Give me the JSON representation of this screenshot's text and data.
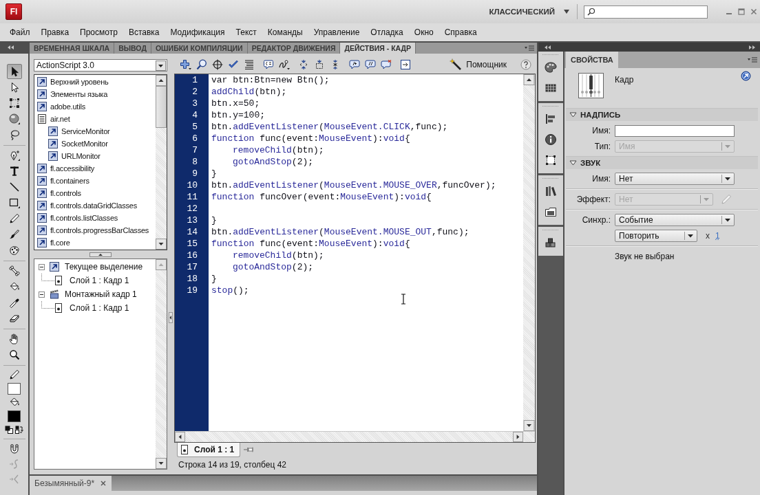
{
  "app": {
    "logo": "Fl",
    "workspace": "КЛАССИЧЕСКИЙ"
  },
  "menu": [
    "Файл",
    "Правка",
    "Просмотр",
    "Вставка",
    "Модификация",
    "Текст",
    "Команды",
    "Управление",
    "Отладка",
    "Окно",
    "Справка"
  ],
  "panel_tabs": [
    {
      "label": "ВРЕМЕННАЯ ШКАЛА",
      "selected": false
    },
    {
      "label": "ВЫВОД",
      "selected": false
    },
    {
      "label": "ОШИБКИ КОМПИЛЯЦИИ",
      "selected": false
    },
    {
      "label": "РЕДАКТОР ДВИЖЕНИЯ",
      "selected": false
    },
    {
      "label": "ДЕЙСТВИЯ - КАДР",
      "selected": true
    }
  ],
  "tool_groups": [
    {
      "tools": [
        {
          "kind": "selection",
          "selected": true
        },
        {
          "kind": "subselection",
          "selected": false
        },
        {
          "kind": "transform",
          "selected": false
        },
        {
          "kind": "rotate3d",
          "selected": false
        },
        {
          "kind": "lasso",
          "selected": false
        }
      ]
    },
    {
      "tools": [
        {
          "kind": "pen",
          "selected": false
        },
        {
          "kind": "text",
          "selected": false
        },
        {
          "kind": "line",
          "selected": false
        },
        {
          "kind": "rectangle",
          "selected": false
        },
        {
          "kind": "pencil",
          "selected": false
        },
        {
          "kind": "brush",
          "selected": false
        },
        {
          "kind": "deco",
          "selected": false
        }
      ]
    },
    {
      "tools": [
        {
          "kind": "bone",
          "selected": false
        },
        {
          "kind": "bucket",
          "selected": false
        },
        {
          "kind": "eyedropper",
          "selected": false
        },
        {
          "kind": "eraser",
          "selected": false
        }
      ]
    },
    {
      "tools": [
        {
          "kind": "hand",
          "selected": false
        },
        {
          "kind": "zoom",
          "selected": false
        }
      ]
    }
  ],
  "color_swatches": [
    {
      "kind": "stroke",
      "color": "#ffffff"
    },
    {
      "kind": "fill",
      "color": "#000000"
    }
  ],
  "tool_options": [
    {
      "kind": "snap",
      "disabled": false
    },
    {
      "kind": "smooth",
      "disabled": true
    },
    {
      "kind": "straighten",
      "disabled": true
    }
  ],
  "actions": {
    "language": "ActionScript 3.0",
    "toolbox": [
      {
        "label": "Верхний уровень",
        "expanded": false
      },
      {
        "label": "Элементы языка",
        "expanded": false
      },
      {
        "label": "adobe.utils",
        "expanded": false
      },
      {
        "label": "air.net",
        "expanded": true,
        "children": [
          {
            "label": "ServiceMonitor",
            "expanded": false
          },
          {
            "label": "SocketMonitor",
            "expanded": false
          },
          {
            "label": "URLMonitor",
            "expanded": false
          }
        ]
      },
      {
        "label": "fl.accessibility",
        "expanded": false
      },
      {
        "label": "fl.containers",
        "expanded": false
      },
      {
        "label": "fl.controls",
        "expanded": false
      },
      {
        "label": "fl.controls.dataGridClasses",
        "expanded": false
      },
      {
        "label": "fl.controls.listClasses",
        "expanded": false
      },
      {
        "label": "fl.controls.progressBarClasses",
        "expanded": false
      },
      {
        "label": "fl.core",
        "expanded": false
      }
    ],
    "navigator": [
      {
        "label": "Текущее выделение",
        "kind": "selection",
        "expanded": true,
        "children": [
          {
            "label": "Слой 1 : Кадр 1"
          }
        ]
      },
      {
        "label": "Монтажный кадр 1",
        "kind": "scene",
        "expanded": true,
        "children": [
          {
            "label": "Слой 1 : Кадр 1"
          }
        ]
      }
    ],
    "assistant": "Помощник",
    "code": [
      {
        "number": "1",
        "parts": [
          {
            "kind": "plain",
            "text": "var btn:Btn=new Btn();"
          }
        ]
      },
      {
        "number": "2",
        "parts": [
          {
            "kind": "keyword",
            "text": "addChild"
          },
          {
            "kind": "plain",
            "text": "(btn);"
          }
        ]
      },
      {
        "number": "3",
        "parts": [
          {
            "kind": "plain",
            "text": "btn.x=50;"
          }
        ]
      },
      {
        "number": "4",
        "parts": [
          {
            "kind": "plain",
            "text": "btn.y=100;"
          }
        ]
      },
      {
        "number": "5",
        "parts": [
          {
            "kind": "plain",
            "text": "btn."
          },
          {
            "kind": "keyword",
            "text": "addEventListener"
          },
          {
            "kind": "plain",
            "text": "("
          },
          {
            "kind": "keyword",
            "text": "MouseEvent.CLICK"
          },
          {
            "kind": "plain",
            "text": ",func);"
          }
        ]
      },
      {
        "number": "6",
        "parts": [
          {
            "kind": "keyword",
            "text": "function"
          },
          {
            "kind": "plain",
            "text": " func(event:"
          },
          {
            "kind": "keyword",
            "text": "MouseEvent"
          },
          {
            "kind": "plain",
            "text": "):"
          },
          {
            "kind": "keyword",
            "text": "void"
          },
          {
            "kind": "plain",
            "text": "{"
          }
        ],
        "children": [
          {
            "number": "7",
            "parts": [
              {
                "kind": "keyword",
                "text": "removeChild"
              },
              {
                "kind": "plain",
                "text": "(btn);"
              }
            ]
          },
          {
            "number": "8",
            "parts": [
              {
                "kind": "keyword",
                "text": "gotoAndStop"
              },
              {
                "kind": "plain",
                "text": "(2);"
              }
            ]
          }
        ]
      },
      {
        "number": "9",
        "parts": [
          {
            "kind": "plain",
            "text": "}"
          }
        ]
      },
      {
        "number": "10",
        "parts": [
          {
            "kind": "plain",
            "text": "btn."
          },
          {
            "kind": "keyword",
            "text": "addEventListener"
          },
          {
            "kind": "plain",
            "text": "("
          },
          {
            "kind": "keyword",
            "text": "MouseEvent.MOUSE_OVER"
          },
          {
            "kind": "plain",
            "text": ",funcOver);"
          }
        ]
      },
      {
        "number": "11",
        "parts": [
          {
            "kind": "keyword",
            "text": "function"
          },
          {
            "kind": "plain",
            "text": " funcOver(event:"
          },
          {
            "kind": "keyword",
            "text": "MouseEvent"
          },
          {
            "kind": "plain",
            "text": "):"
          },
          {
            "kind": "keyword",
            "text": "void"
          },
          {
            "kind": "plain",
            "text": "{"
          }
        ]
      },
      {
        "number": "12"
      },
      {
        "number": "13",
        "parts": [
          {
            "kind": "plain",
            "text": "}"
          }
        ]
      },
      {
        "number": "14",
        "parts": [
          {
            "kind": "plain",
            "text": "btn."
          },
          {
            "kind": "keyword",
            "text": "addEventListener"
          },
          {
            "kind": "plain",
            "text": "("
          },
          {
            "kind": "keyword",
            "text": "MouseEvent.MOUSE_OUT"
          },
          {
            "kind": "plain",
            "text": ",func);"
          }
        ]
      },
      {
        "number": "15",
        "parts": [
          {
            "kind": "keyword",
            "text": "function"
          },
          {
            "kind": "plain",
            "text": " func(event:"
          },
          {
            "kind": "keyword",
            "text": "MouseEvent"
          },
          {
            "kind": "plain",
            "text": "):"
          },
          {
            "kind": "keyword",
            "text": "void"
          },
          {
            "kind": "plain",
            "text": "{"
          }
        ],
        "children": [
          {
            "number": "16",
            "parts": [
              {
                "kind": "keyword",
                "text": "removeChild"
              },
              {
                "kind": "plain",
                "text": "(btn);"
              }
            ]
          },
          {
            "number": "17",
            "parts": [
              {
                "kind": "keyword",
                "text": "gotoAndStop"
              },
              {
                "kind": "plain",
                "text": "(2);"
              }
            ]
          }
        ]
      },
      {
        "number": "18",
        "parts": [
          {
            "kind": "plain",
            "text": "}"
          }
        ]
      },
      {
        "number": "19",
        "parts": [
          {
            "kind": "keyword",
            "text": "stop"
          },
          {
            "kind": "plain",
            "text": "();"
          }
        ]
      }
    ],
    "script_tab": "Слой 1 : 1",
    "status": "Строка 14 из 19, столбец 42"
  },
  "documents": [
    {
      "title": "Безымянный-9*",
      "selected": true
    }
  ],
  "properties": {
    "tab": "СВОЙСТВА",
    "object": "Кадр",
    "sections": [
      {
        "title": "НАДПИСЬ",
        "expanded": true,
        "groups": [
          {
            "rows": [
              {
                "kind": "input",
                "label": "Имя:"
              },
              {
                "kind": "select",
                "label": "Тип:",
                "value": "Имя",
                "disabled": true,
                "edit_button": false
              }
            ]
          }
        ]
      },
      {
        "title": "ЗВУК",
        "expanded": true,
        "groups": [
          {
            "rows": [
              {
                "kind": "select",
                "label": "Имя:",
                "value": "Нет",
                "disabled": false,
                "edit_button": false
              }
            ]
          },
          {
            "rows": [
              {
                "kind": "select",
                "label": "Эффект:",
                "value": "Нет",
                "disabled": true,
                "edit_button": true
              }
            ]
          },
          {
            "rows": [
              {
                "kind": "select",
                "label": "Синхр.:",
                "value": "Событие",
                "disabled": false,
                "edit_button": false
              },
              {
                "kind": "repeat",
                "value": "Повторить",
                "times": "x",
                "count": "1"
              }
            ]
          },
          {
            "rows": [
              {
                "kind": "note",
                "text": "Звук не выбран"
              }
            ]
          }
        ]
      }
    ]
  }
}
